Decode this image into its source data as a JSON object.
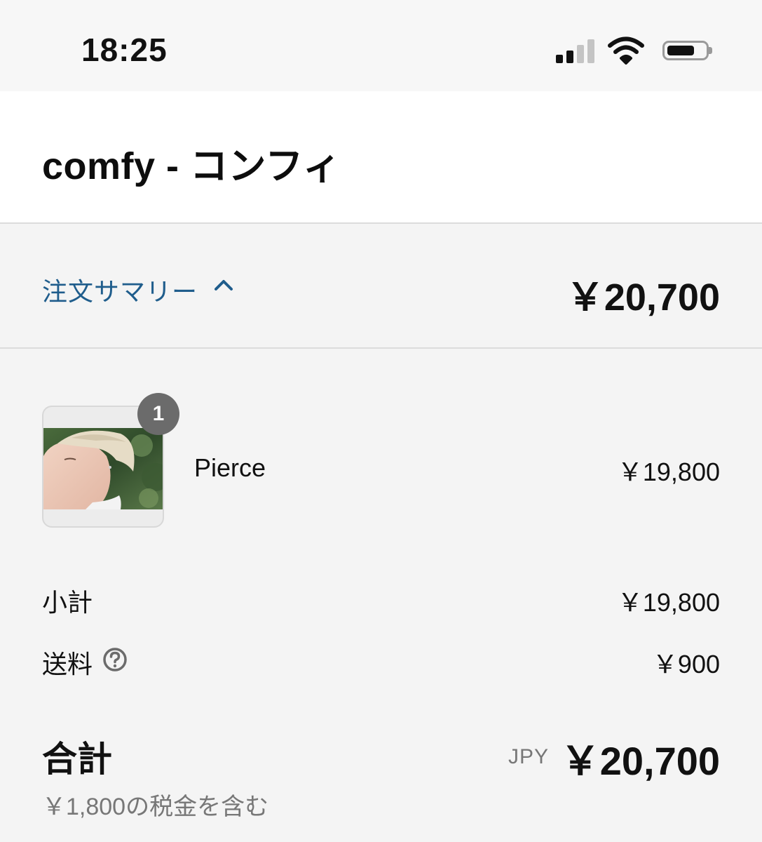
{
  "status_bar": {
    "time": "18:25",
    "icons": [
      "signal-icon",
      "wifi-icon",
      "battery-icon"
    ]
  },
  "store": {
    "name": "comfy - コンフィ"
  },
  "summary": {
    "toggle_label": "注文サマリー",
    "toggle_icon": "chevron-up-icon",
    "total": "￥20,700",
    "accent_color": "#1f5d8c"
  },
  "line_items": [
    {
      "quantity": "1",
      "name": "Pierce",
      "price": "￥19,800"
    }
  ],
  "costs": {
    "subtotal_label": "小計",
    "subtotal_value": "￥19,800",
    "shipping_label": "送料",
    "shipping_value": "￥900",
    "shipping_help_icon": "question-circle-icon"
  },
  "total": {
    "label": "合計",
    "currency": "JPY",
    "value": "￥20,700",
    "tax_note": "￥1,800の税金を含む"
  }
}
